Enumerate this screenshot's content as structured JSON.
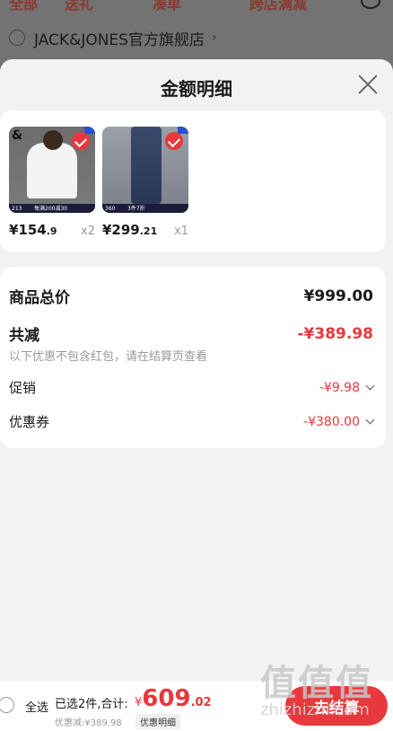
{
  "background": {
    "tabs": [
      "全部",
      "送礼",
      "凑单",
      "跨店满减"
    ],
    "store_name": "JACK&JONES官方旗舰店"
  },
  "sheet": {
    "title": "金额明细"
  },
  "products": [
    {
      "price_int": "¥154",
      "price_dec": ".9",
      "qty": "x2",
      "badge": "213",
      "strip": "每满200减30",
      "logo": "&"
    },
    {
      "price_int": "¥299",
      "price_dec": ".21",
      "qty": "x1",
      "badge": "360",
      "strip": "3件7折"
    }
  ],
  "summary": {
    "total_label": "商品总价",
    "total_value": "¥999.00",
    "discount_label": "共减",
    "discount_value": "-¥389.98",
    "discount_note": "以下优惠不包含红包，请在结算页查看",
    "promo_label": "促销",
    "promo_value": "-¥9.98",
    "coupon_label": "优惠券",
    "coupon_value": "-¥380.00"
  },
  "bottom": {
    "select_all": "全选",
    "selected_text": "已选2件,合计:",
    "currency": "¥",
    "total_int": "609",
    "total_dec": ".02",
    "discount_note": "优惠减:¥389.98",
    "detail_label": "优惠明细",
    "checkout_label": "去结算"
  },
  "watermark": {
    "mark": "值值值",
    "url": "zhizhizhi.com"
  },
  "colors": {
    "accent_red": "#e8383d",
    "overlay": "#6b6b6b",
    "sheet_bg": "#f2f2f2"
  }
}
